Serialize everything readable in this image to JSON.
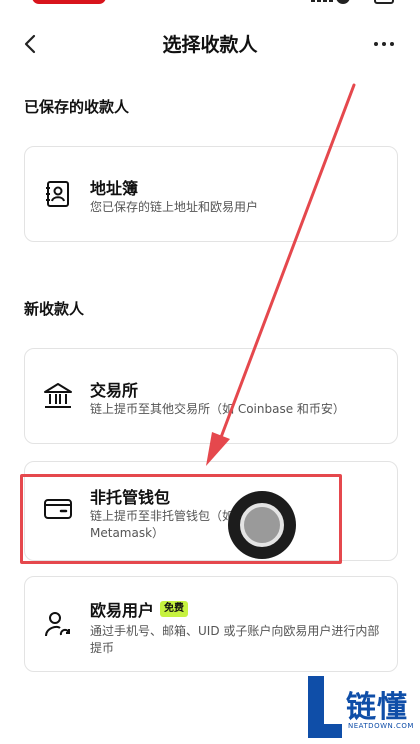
{
  "header": {
    "title": "选择收款人"
  },
  "saved_section": {
    "title": "已保存的收款人",
    "address_book": {
      "icon": "address-book-icon",
      "title": "地址簿",
      "desc": "您已保存的链上地址和欧易用户"
    }
  },
  "new_section": {
    "title": "新收款人",
    "exchange": {
      "icon": "bank-icon",
      "title": "交易所",
      "desc": "链上提币至其他交易所（如 Coinbase 和币安）"
    },
    "wallet": {
      "icon": "wallet-icon",
      "title": "非托管钱包",
      "desc": "链上提币至非托管钱包（如 Wallet 和 Metamask）"
    },
    "okx_user": {
      "icon": "user-icon",
      "title": "欧易用户",
      "badge": "免费",
      "desc": "通过手机号、邮箱、UID 或子账户向欧易用户进行内部提币"
    }
  },
  "watermark": {
    "text": "链懂",
    "sub": "NEATDOWN.COM"
  },
  "colors": {
    "annotation_red": "#e5484d",
    "badge_green": "#c6f23f",
    "watermark_blue": "#0f4ea8"
  }
}
